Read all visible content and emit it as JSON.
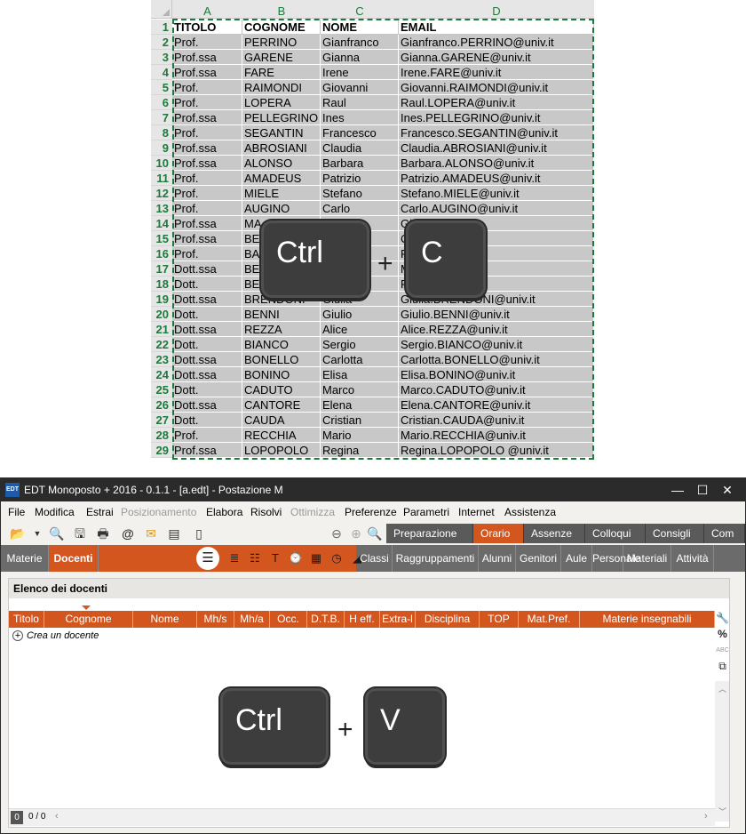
{
  "sheet": {
    "columns": [
      "A",
      "B",
      "C",
      "D"
    ],
    "headers": [
      "TITOLO",
      "COGNOME",
      "NOME",
      "EMAIL"
    ],
    "rows": [
      [
        "Prof.",
        "PERRINO",
        "Gianfranco",
        "Gianfranco.PERRINO@univ.it"
      ],
      [
        "Prof.ssa",
        "GARENE",
        "Gianna",
        "Gianna.GARENE@univ.it"
      ],
      [
        "Prof.ssa",
        "FARE",
        "Irene",
        "Irene.FARE@univ.it"
      ],
      [
        "Prof.",
        "RAIMONDI",
        "Giovanni",
        "Giovanni.RAIMONDI@univ.it"
      ],
      [
        "Prof.",
        "LOPERA",
        "Raul",
        "Raul.LOPERA@univ.it"
      ],
      [
        "Prof.ssa",
        "PELLEGRINO",
        "Ines",
        "Ines.PELLEGRINO@univ.it"
      ],
      [
        "Prof.",
        "SEGANTIN",
        "Francesco",
        "Francesco.SEGANTIN@univ.it"
      ],
      [
        "Prof.ssa",
        "ABROSIANI",
        "Claudia",
        "Claudia.ABROSIANI@univ.it"
      ],
      [
        "Prof.ssa",
        "ALONSO",
        "Barbara",
        "Barbara.ALONSO@univ.it"
      ],
      [
        "Prof.",
        "AMADEUS",
        "Patrizio",
        "Patrizio.AMADEUS@univ.it"
      ],
      [
        "Prof.",
        "MIELE",
        "Stefano",
        "Stefano.MIELE@univ.it"
      ],
      [
        "Prof.",
        "AUGINO",
        "Carlo",
        "Carlo.AUGINO@univ.it"
      ],
      [
        "Prof.ssa",
        "MA",
        "",
        "Gi                 @univ.it"
      ],
      [
        "Prof.ssa",
        "BE",
        "",
        "C                  ETTA@univ.it"
      ],
      [
        "Prof.",
        "BA",
        "",
        "F                  CO@univ.it"
      ],
      [
        "Dott.ssa",
        "BE",
        "",
        "M                  @univ.it"
      ],
      [
        "Dott.",
        "BE",
        "",
        "F                  ARDO@univ.it"
      ],
      [
        "Dott.ssa",
        "BRENDONI",
        "Giulia",
        "Giulia.BRENDONI@univ.it"
      ],
      [
        "Dott.",
        "BENNI",
        "Giulio",
        "Giulio.BENNI@univ.it"
      ],
      [
        "Dott.ssa",
        "REZZA",
        "Alice",
        "Alice.REZZA@univ.it"
      ],
      [
        "Dott.",
        "BIANCO",
        "Sergio",
        "Sergio.BIANCO@univ.it"
      ],
      [
        "Dott.ssa",
        "BONELLO",
        "Carlotta",
        "Carlotta.BONELLO@univ.it"
      ],
      [
        "Dott.ssa",
        "BONINO",
        "Elisa",
        "Elisa.BONINO@univ.it"
      ],
      [
        "Dott.",
        "CADUTO",
        "Marco",
        "Marco.CADUTO@univ.it"
      ],
      [
        "Dott.ssa",
        "CANTORE",
        "Elena",
        "Elena.CANTORE@univ.it"
      ],
      [
        "Dott.",
        "CAUDA",
        "Cristian",
        "Cristian.CAUDA@univ.it"
      ],
      [
        "Prof.",
        "RECCHIA",
        "Mario",
        "Mario.RECCHIA@univ.it"
      ],
      [
        "Prof.ssa",
        "LOPOPOLO",
        "Regina",
        "Regina.LOPOPOLO @univ.it"
      ]
    ]
  },
  "keys": {
    "copy": {
      "mod": "Ctrl",
      "key": "C",
      "plus": "+"
    },
    "paste": {
      "mod": "Ctrl",
      "key": "V",
      "plus": "+"
    }
  },
  "window": {
    "logo": "EDT",
    "title": "EDT Monoposto + 2016 - 0.1.1 - [a.edt] - Postazione M",
    "minimize": "—",
    "maximize": "☐",
    "close": "✕"
  },
  "menu": [
    {
      "label": "File",
      "disabled": false
    },
    {
      "label": "Modifica",
      "disabled": false
    },
    {
      "label": "Estrai",
      "disabled": false
    },
    {
      "label": "Posizionamento",
      "disabled": true
    },
    {
      "label": "Elabora",
      "disabled": false
    },
    {
      "label": "Risolvi",
      "disabled": false
    },
    {
      "label": "Ottimizza",
      "disabled": true
    },
    {
      "label": "Preferenze",
      "disabled": false
    },
    {
      "label": "Parametri",
      "disabled": false
    },
    {
      "label": "Internet",
      "disabled": false
    },
    {
      "label": "Assistenza",
      "disabled": false
    }
  ],
  "nav_tabs": [
    "Preparazione",
    "Orario",
    "Assenze",
    "Colloqui",
    "Consigli",
    "Com"
  ],
  "nav_active": "Orario",
  "sub_tabs_left": [
    "Materie",
    "Docenti"
  ],
  "sub_tabs_right": [
    "Classi",
    "Raggruppamenti",
    "Alunni",
    "Genitori",
    "Aule",
    "Personale",
    "Materiali",
    "Attività"
  ],
  "panel": {
    "title": "Elenco dei docenti",
    "columns": [
      "Titolo",
      "Cognome",
      "Nome",
      "Mh/s",
      "Mh/a",
      "Occ.",
      "D.T.B.",
      "H eff.",
      "Extra-l",
      "Disciplina",
      "TOP",
      "Mat.Pref.",
      "Materie insegnabili"
    ],
    "create_label": "Crea un docente",
    "status_count": "0",
    "status_ratio": "0 / 0"
  },
  "colors": {
    "accent": "#d4561f",
    "excel_green": "#1d7a3a"
  }
}
